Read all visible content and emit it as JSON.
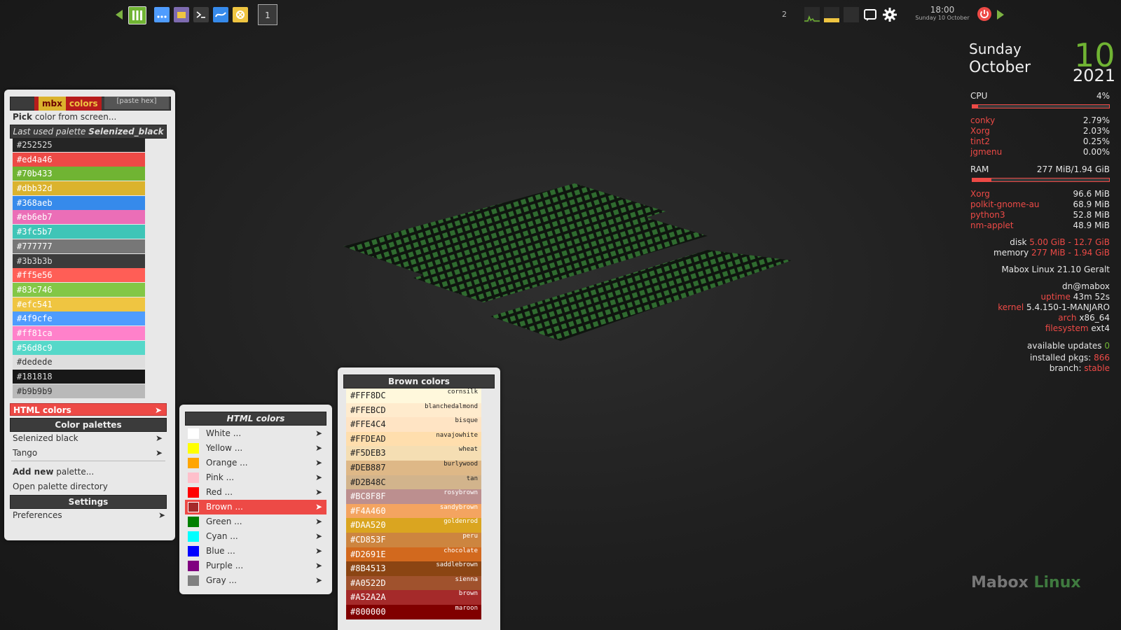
{
  "panel": {
    "launchers": [
      {
        "icon": "menu-bars-icon",
        "color": "#70b433"
      },
      {
        "icon": "dots-icon",
        "color": "#4f9cfe"
      },
      {
        "icon": "folder-icon",
        "color": "#7e6bb0"
      },
      {
        "icon": "terminal-icon",
        "color": "#3b3b3b"
      },
      {
        "icon": "browser-icon",
        "color": "#368aeb"
      },
      {
        "icon": "settings-app-icon",
        "color": "#efc541"
      }
    ],
    "workspace": "1",
    "desktop_count": "2",
    "clock_time": "18:00",
    "clock_date": "Sunday 10 October"
  },
  "date_widget": {
    "weekday": "Sunday",
    "month": "October",
    "year": "2021",
    "day": "10"
  },
  "conky": {
    "cpu_label": "CPU",
    "cpu_value": "4%",
    "cpu_fraction": 0.04,
    "cpu_procs": [
      {
        "name": "conky",
        "value": "2.79%"
      },
      {
        "name": "Xorg",
        "value": "2.03%"
      },
      {
        "name": "tint2",
        "value": "0.25%"
      },
      {
        "name": "jgmenu",
        "value": "0.00%"
      }
    ],
    "ram_label": "RAM",
    "ram_value": "277 MiB/1.94 GiB",
    "ram_fraction": 0.14,
    "ram_procs": [
      {
        "name": "Xorg",
        "value": "96.6 MiB"
      },
      {
        "name": "polkit-gnome-au",
        "value": "68.9 MiB"
      },
      {
        "name": "python3",
        "value": "52.8 MiB"
      },
      {
        "name": "nm-applet",
        "value": "48.9 MiB"
      }
    ],
    "disk_label": "disk",
    "disk_value": "5.00 GiB - 12.7 GiB",
    "memory_label": "memory",
    "memory_value": "277 MiB - 1.94 GiB",
    "distro": "Mabox Linux 21.10 Geralt",
    "user": "dn@mabox",
    "uptime_label": "uptime",
    "uptime_value": "43m 52s",
    "kernel_label": "kernel",
    "kernel_value": "5.4.150-1-MANJARO",
    "arch_label": "arch",
    "arch_value": "x86_64",
    "fs_label": "filesystem",
    "fs_value": "ext4",
    "updates_label": "available updates",
    "updates_value": "0",
    "pkgs_label": "installed pkgs:",
    "pkgs_value": "866",
    "branch_label": "branch:",
    "branch_value": "stable"
  },
  "watermark": {
    "part1": "Mabox",
    "part2": "Linux"
  },
  "main_menu": {
    "logo_a": "mbx",
    "logo_b": "colors",
    "paste_hex": "[paste hex]",
    "pick_bold": "Pick",
    "pick_rest": " color from screen...",
    "last_used_prefix": "Last used palette",
    "last_used_name": "Selenized_black",
    "swatches": [
      {
        "hex": "#252525",
        "fg": "#dddddd"
      },
      {
        "hex": "#ed4a46",
        "fg": "#ffffff"
      },
      {
        "hex": "#70b433",
        "fg": "#ffffff"
      },
      {
        "hex": "#dbb32d",
        "fg": "#ffffff"
      },
      {
        "hex": "#368aeb",
        "fg": "#ffffff"
      },
      {
        "hex": "#eb6eb7",
        "fg": "#ffffff"
      },
      {
        "hex": "#3fc5b7",
        "fg": "#ffffff"
      },
      {
        "hex": "#777777",
        "fg": "#ffffff"
      },
      {
        "hex": "#3b3b3b",
        "fg": "#dddddd"
      },
      {
        "hex": "#ff5e56",
        "fg": "#ffffff"
      },
      {
        "hex": "#83c746",
        "fg": "#ffffff"
      },
      {
        "hex": "#efc541",
        "fg": "#ffffff"
      },
      {
        "hex": "#4f9cfe",
        "fg": "#ffffff"
      },
      {
        "hex": "#ff81ca",
        "fg": "#ffffff"
      },
      {
        "hex": "#56d8c9",
        "fg": "#ffffff"
      },
      {
        "hex": "#dedede",
        "fg": "#333333"
      },
      {
        "hex": "#181818",
        "fg": "#dddddd"
      },
      {
        "hex": "#b9b9b9",
        "fg": "#333333"
      }
    ],
    "html_colors": "HTML colors",
    "palettes_header": "Color palettes",
    "palettes": [
      "Selenized black",
      "Tango"
    ],
    "add_new_bold": "Add new",
    "add_new_rest": " palette...",
    "open_dir": "Open palette directory",
    "settings_header": "Settings",
    "preferences": "Preferences"
  },
  "html_menu": {
    "header": "HTML colors",
    "items": [
      {
        "label": "White ...",
        "color": "#ffffff"
      },
      {
        "label": "Yellow ...",
        "color": "#ffff00"
      },
      {
        "label": "Orange ...",
        "color": "#ffa500"
      },
      {
        "label": "Pink ...",
        "color": "#ffc0cb"
      },
      {
        "label": "Red ...",
        "color": "#ff0000"
      },
      {
        "label": "Brown ...",
        "color": "#a52a2a"
      },
      {
        "label": "Green ...",
        "color": "#008000"
      },
      {
        "label": "Cyan ...",
        "color": "#00ffff"
      },
      {
        "label": "Blue ...",
        "color": "#0000ff"
      },
      {
        "label": "Purple ...",
        "color": "#800080"
      },
      {
        "label": "Gray ...",
        "color": "#808080"
      }
    ],
    "active_index": 5
  },
  "brown_menu": {
    "header": "Brown colors",
    "items": [
      {
        "hex": "#FFF8DC",
        "name": "cornsilk",
        "fg": "#222222"
      },
      {
        "hex": "#FFEBCD",
        "name": "blanchedalmond",
        "fg": "#222222"
      },
      {
        "hex": "#FFE4C4",
        "name": "bisque",
        "fg": "#222222"
      },
      {
        "hex": "#FFDEAD",
        "name": "navajowhite",
        "fg": "#222222"
      },
      {
        "hex": "#F5DEB3",
        "name": "wheat",
        "fg": "#222222"
      },
      {
        "hex": "#DEB887",
        "name": "burlywood",
        "fg": "#222222"
      },
      {
        "hex": "#D2B48C",
        "name": "tan",
        "fg": "#222222"
      },
      {
        "hex": "#BC8F8F",
        "name": "rosybrown",
        "fg": "#ffffff"
      },
      {
        "hex": "#F4A460",
        "name": "sandybrown",
        "fg": "#ffffff"
      },
      {
        "hex": "#DAA520",
        "name": "goldenrod",
        "fg": "#ffffff"
      },
      {
        "hex": "#CD853F",
        "name": "peru",
        "fg": "#ffffff"
      },
      {
        "hex": "#D2691E",
        "name": "chocolate",
        "fg": "#ffffff"
      },
      {
        "hex": "#8B4513",
        "name": "saddlebrown",
        "fg": "#ffffff"
      },
      {
        "hex": "#A0522D",
        "name": "sienna",
        "fg": "#ffffff"
      },
      {
        "hex": "#A52A2A",
        "name": "brown",
        "fg": "#ffffff"
      },
      {
        "hex": "#800000",
        "name": "maroon",
        "fg": "#ffffff"
      }
    ]
  }
}
